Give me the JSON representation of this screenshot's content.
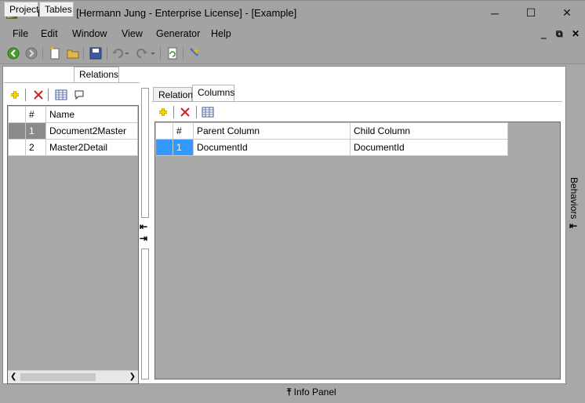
{
  "window": {
    "title": "BCF Editor [Hermann Jung - Enterprise License] - [Example]",
    "controls": {
      "minimize": "─",
      "maximize": "☐",
      "close": "✕"
    }
  },
  "menu": {
    "items": [
      "File",
      "Edit",
      "Window",
      "View",
      "Generator",
      "Help"
    ],
    "mdi": {
      "minimize": "‗",
      "restore": "⧉",
      "close": "✕"
    }
  },
  "toolbar": {
    "icons": [
      "back-icon",
      "forward-icon",
      "new-icon",
      "open-icon",
      "save-icon",
      "undo-icon",
      "redo-icon",
      "refresh-icon",
      "generate-icon"
    ]
  },
  "left_tabs": [
    "Project",
    "Tables",
    "Relations"
  ],
  "left_grid": {
    "headers": [
      "#",
      "Name"
    ],
    "rows": [
      {
        "num": "1",
        "name": "Document2Master"
      },
      {
        "num": "2",
        "name": "Master2Detail"
      }
    ]
  },
  "right_tabs": [
    "Relation",
    "Columns"
  ],
  "right_grid": {
    "headers": [
      "#",
      "Parent Column",
      "Child Column"
    ],
    "rows": [
      {
        "num": "1",
        "parent": "DocumentId",
        "child": "DocumentId"
      }
    ]
  },
  "side_panel": {
    "label": "Behaviors"
  },
  "bottom_panel": {
    "label": "Info Panel"
  },
  "colors": {
    "selection_blue": "#3399ff",
    "chrome_gray": "#a3a3a3",
    "add_yellow": "#e8c400",
    "delete_red": "#d32020"
  }
}
